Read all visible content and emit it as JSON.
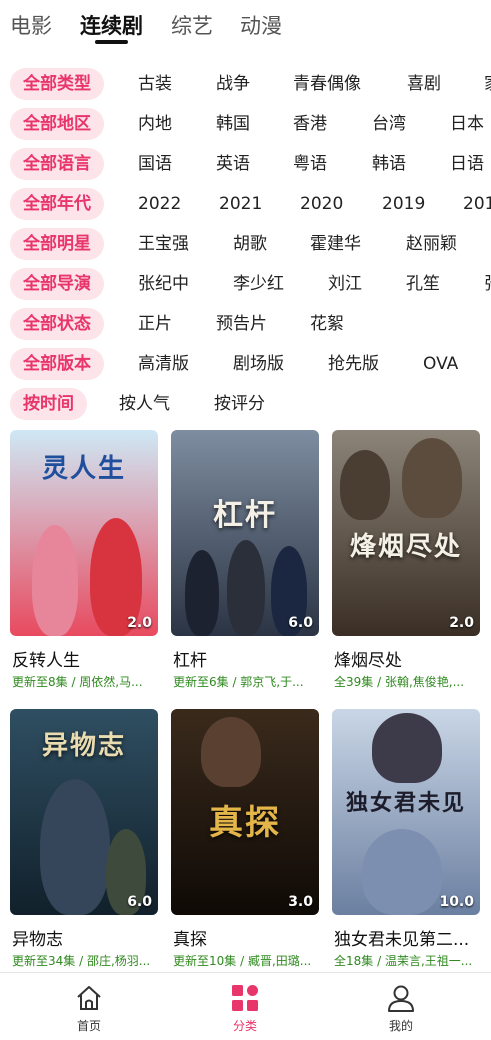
{
  "top_tabs": [
    "电影",
    "连续剧",
    "综艺",
    "动漫"
  ],
  "filters": [
    {
      "label": "全部类型",
      "options": [
        "古装",
        "战争",
        "青春偶像",
        "喜剧",
        "家"
      ]
    },
    {
      "label": "全部地区",
      "options": [
        "内地",
        "韩国",
        "香港",
        "台湾",
        "日本"
      ]
    },
    {
      "label": "全部语言",
      "options": [
        "国语",
        "英语",
        "粤语",
        "韩语",
        "日语"
      ]
    },
    {
      "label": "全部年代",
      "options": [
        "2022",
        "2021",
        "2020",
        "2019",
        "201"
      ]
    },
    {
      "label": "全部明星",
      "options": [
        "王宝强",
        "胡歌",
        "霍建华",
        "赵丽颖"
      ]
    },
    {
      "label": "全部导演",
      "options": [
        "张纪中",
        "李少红",
        "刘江",
        "孔笙",
        "张"
      ]
    },
    {
      "label": "全部状态",
      "options": [
        "正片",
        "预告片",
        "花絮"
      ]
    },
    {
      "label": "全部版本",
      "options": [
        "高清版",
        "剧场版",
        "抢先版",
        "OVA"
      ]
    },
    {
      "label": "按时间",
      "options": [
        "按人气",
        "按评分"
      ]
    }
  ],
  "shows": [
    {
      "title": "反转人生",
      "subtitle": "更新至8集 / 周依然,马...",
      "score": "2.0",
      "poster_text": "灵人生",
      "colors": [
        "#cfe8f5",
        "#e84a5f"
      ]
    },
    {
      "title": "杠杆",
      "subtitle": "更新至6集 / 郭京飞,于...",
      "score": "6.0",
      "poster_text": "杠杆",
      "colors": [
        "#7e8da0",
        "#2b3444"
      ]
    },
    {
      "title": "烽烟尽处",
      "subtitle": "全39集 / 张翰,焦俊艳,...",
      "score": "2.0",
      "poster_text": "烽烟尽处",
      "colors": [
        "#8c8478",
        "#3a2e25"
      ]
    },
    {
      "title": "异物志",
      "subtitle": "更新至34集 / 邵庄,杨羽...",
      "score": "6.0",
      "poster_text": "异物志",
      "colors": [
        "#2f4f62",
        "#11202b"
      ]
    },
    {
      "title": "真探",
      "subtitle": "更新至10集 / 臧晋,田璐...",
      "score": "3.0",
      "poster_text": "真探",
      "colors": [
        "#3a2a1c",
        "#0f0a06"
      ]
    },
    {
      "title": "独女君未见第二...",
      "subtitle": "全18集 / 温茉言,王祖一...",
      "score": "10.0",
      "poster_text": "独女君未见",
      "colors": [
        "#c9d6e6",
        "#6b7fa0"
      ]
    }
  ],
  "bottom_nav": [
    "首页",
    "分类",
    "我的"
  ],
  "accent_color": "#e8366b"
}
